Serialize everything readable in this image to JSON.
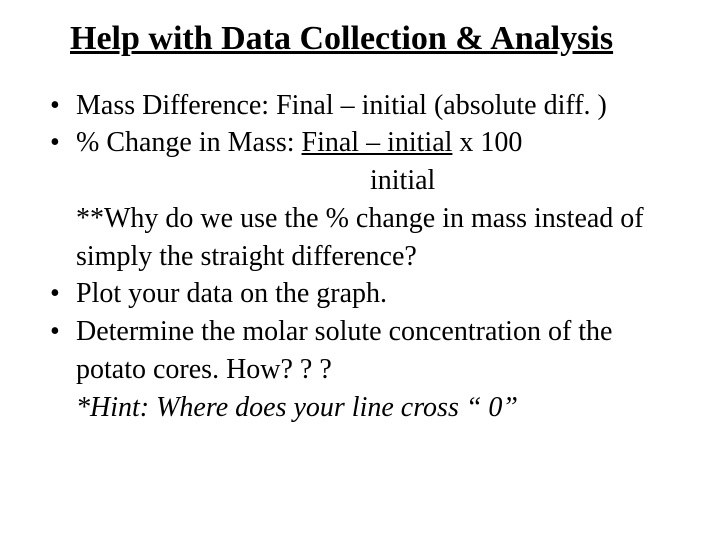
{
  "title": "Help with Data Collection & Analysis",
  "bullets": {
    "b1": "Mass Difference:  Final – initial (absolute diff. )",
    "b2_prefix": "% Change in Mass:  ",
    "b2_num": "Final – initial",
    "b2_suffix": "  x 100",
    "b2_denom": "initial",
    "why": "**Why do we use the % change in mass instead of simply the straight difference?",
    "b3": "Plot your data on the graph.",
    "b4": "Determine the molar solute concentration of the potato cores.  How? ? ?",
    "hint": "*Hint: Where does your line cross “ 0”"
  }
}
